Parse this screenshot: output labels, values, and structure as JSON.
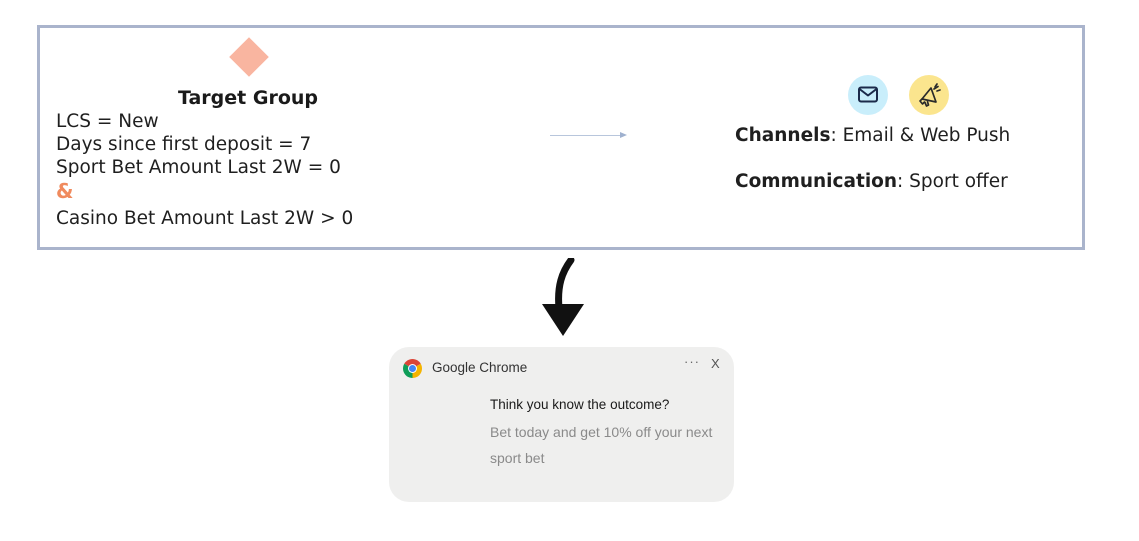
{
  "target_group": {
    "title": "Target Group",
    "conditions": [
      "LCS = New",
      "Days since first deposit = 7",
      "Sport Bet Amount Last 2W = 0"
    ],
    "operator": "&",
    "last_condition": "Casino Bet Amount Last 2W > 0"
  },
  "channels": {
    "label": "Channels",
    "value": ": Email & Web Push",
    "icons": [
      "email-icon",
      "megaphone-icon"
    ]
  },
  "communication": {
    "label": "Communication",
    "value": ": Sport offer"
  },
  "notification": {
    "app_name": "Google Chrome",
    "more_label": "···",
    "close_label": "X",
    "title": "Think you know the outcome?",
    "body": "Bet today and get 10% off your next sport bet"
  },
  "colors": {
    "box_border": "#aab4cc",
    "diamond": "#f9b5a0",
    "operator": "#f08a5d",
    "email_icon_bg": "#c9eefb",
    "push_icon_bg": "#fbe58e",
    "notification_bg": "#efefee"
  }
}
